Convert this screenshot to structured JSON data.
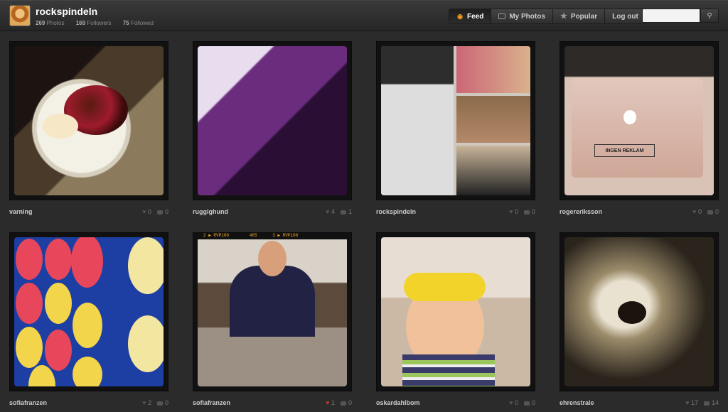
{
  "header": {
    "username": "rockspindeln",
    "stats": {
      "photos_count": "269",
      "photos_label": "Photos",
      "followers_count": "169",
      "followers_label": "Followers",
      "followed_count": "75",
      "followed_label": "Followed"
    },
    "nav": {
      "feed": "Feed",
      "my_photos": "My Photos",
      "popular": "Popular",
      "logout": "Log out"
    },
    "search": {
      "placeholder": "",
      "button_icon": "search-icon"
    }
  },
  "tiles": [
    {
      "owner": "varning",
      "likes": "0",
      "comments": "0",
      "liked": false
    },
    {
      "owner": "ruggighund",
      "likes": "4",
      "comments": "1",
      "liked": false
    },
    {
      "owner": "rockspindeln",
      "likes": "0",
      "comments": "0",
      "liked": false
    },
    {
      "owner": "rogereriksson",
      "likes": "0",
      "comments": "0",
      "liked": false
    },
    {
      "owner": "sofiafranzen",
      "likes": "2",
      "comments": "0",
      "liked": false
    },
    {
      "owner": "sofiafranzen",
      "likes": "1",
      "comments": "0",
      "liked": true
    },
    {
      "owner": "oskardahlbom",
      "likes": "0",
      "comments": "0",
      "liked": false
    },
    {
      "owner": "ehrenstrale",
      "likes": "17",
      "comments": "14",
      "liked": false
    }
  ],
  "photo_text": {
    "laptop_sticker": "INGEN REKLAM",
    "film_strip": "2 ▶ RVP100        465      3 ▶ RVP100"
  },
  "colors": {
    "background": "#2b2b2b",
    "header": "#2f2f2f",
    "rss_icon": "#f59a23",
    "liked_heart": "#c0392b"
  }
}
